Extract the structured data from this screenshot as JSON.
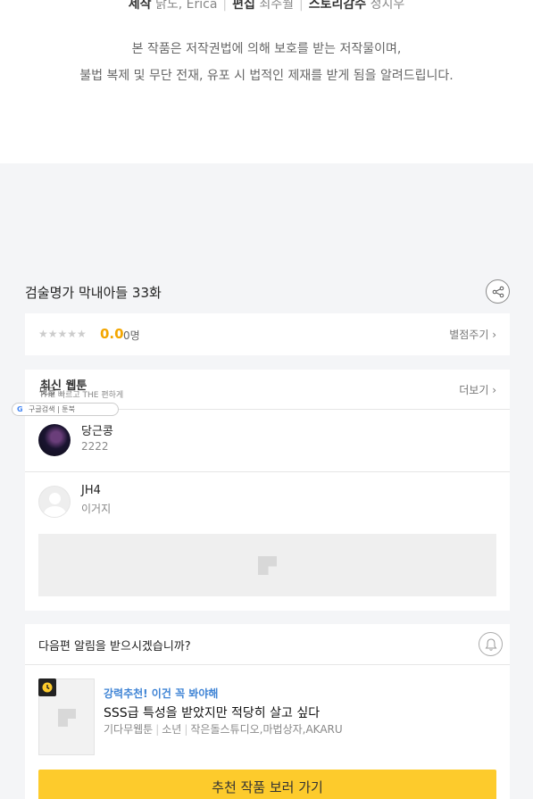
{
  "credits": {
    "writer_label": "제작",
    "writer_value": "닭도, Erica",
    "editor_label": "편집",
    "editor_value": "최주월",
    "story_label": "스토리감수",
    "story_value": "정지우"
  },
  "notice": {
    "line1": "본 작품은 저작권법에 의해 보호를 받는 저작물이며,",
    "line2": "불법 복제 및 무단 전재, 유포 시 법적인 제재를 받게 됨을 알려드립니다."
  },
  "episode": {
    "title": "검술명가 막내아들 33화"
  },
  "rating": {
    "stars": "★★★★★",
    "score": "0.0",
    "count": "0명",
    "rate_button": "별점주기 ›"
  },
  "comments": {
    "header": "최신 웹툰",
    "more_button": "더보기 ›",
    "overlay_top": "댓글",
    "overlay_line": "THE 빠르고 THE 편하게",
    "overlay_pill_google": "G",
    "overlay_pill_text": "구글검색 | 툰북",
    "items": [
      {
        "nickname": "당근콩",
        "text": "2222"
      },
      {
        "nickname": "JH4",
        "text": "이거지"
      }
    ]
  },
  "recommend": {
    "question": "다음편 알림을 받으시겠습니까?",
    "tag": "강력추천! 이건 꼭 봐야해",
    "title": "SSS급 특성을 받았지만 적당히 살고 싶다",
    "meta_type": "기다무웹툰",
    "meta_genre": "소년",
    "meta_authors": "작은돌스튜디오,마법상자,AKARU",
    "button": "추천 작품 보러 가기"
  },
  "colors": {
    "accent_yellow": "#fdcb2c",
    "score_orange": "#f3a600",
    "tag_blue": "#3f84d5"
  },
  "icons": [
    "share-icon",
    "star-icon",
    "chevron-right-icon",
    "bell-icon",
    "clock-icon",
    "image-placeholder-icon"
  ]
}
